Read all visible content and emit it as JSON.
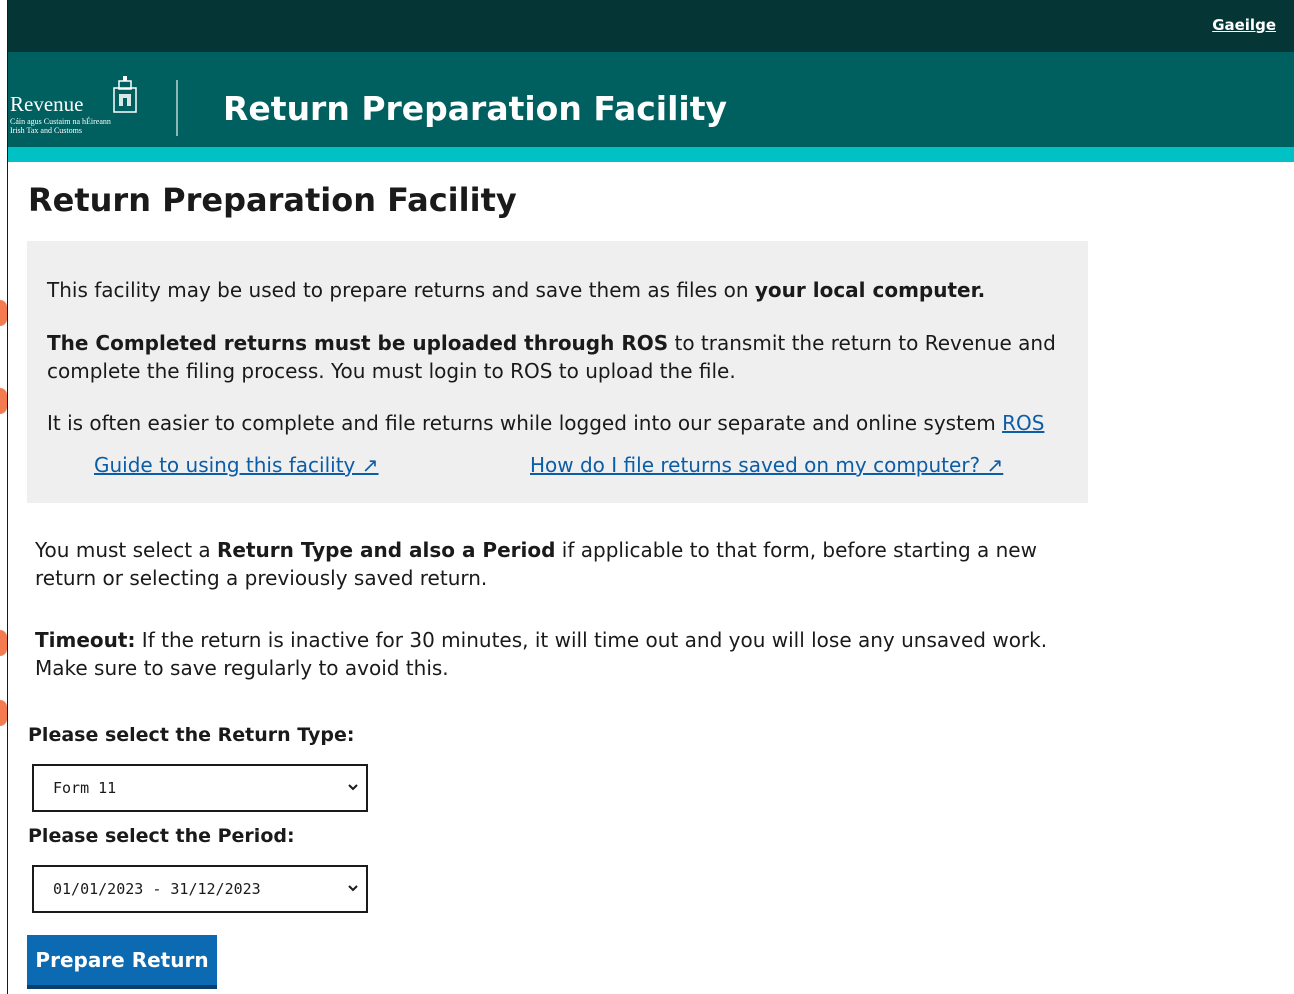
{
  "topbar": {
    "language_link": "Gaeilge"
  },
  "header": {
    "logo": {
      "wordmark": "Revenue",
      "subtitle_line1": "Cáin agus Custaim na hÉireann",
      "subtitle_line2": "Irish Tax and Customs"
    },
    "title": "Return Preparation Facility"
  },
  "page": {
    "title": "Return Preparation Facility"
  },
  "info": {
    "p1_text": "This facility may be used to prepare returns and save them as files on ",
    "p1_bold": "your local computer.",
    "p2_bold": "The Completed returns must be uploaded through ROS",
    "p2_text": " to transmit the return to Revenue and complete the filing process. You must login to ROS to upload the file.",
    "p3_text": "It is often easier to complete and file returns while logged into our separate and online system ",
    "p3_link": "ROS",
    "guide_link": "Guide to using this facility ↗",
    "howto_link": "How do I file returns saved on my computer? ↗"
  },
  "instructions": {
    "select_pre": "You must select a ",
    "select_bold": "Return Type and also a Period",
    "select_post": " if applicable to that form, before starting a new return or selecting a previously saved return.",
    "timeout_bold": "Timeout:",
    "timeout_text": " If the return is inactive for 30 minutes, it will time out and you will lose any unsaved work. Make sure to save regularly to avoid this."
  },
  "form": {
    "return_type_label": "Please select the Return Type:",
    "return_type_value": "Form 11",
    "period_label": "Please select the Period:",
    "period_value": "01/01/2023 - 31/12/2023",
    "submit_label": "Prepare Return"
  },
  "colors": {
    "topbar": "#063536",
    "header": "#005f5f",
    "stripe": "#00c2c4",
    "link": "#0b5da8",
    "button": "#0b6ab1",
    "info_bg": "#efefef"
  }
}
